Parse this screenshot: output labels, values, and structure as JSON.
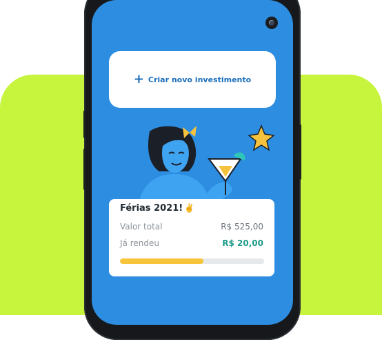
{
  "create_card": {
    "label": "Criar novo investimento",
    "icon": "plus-icon"
  },
  "investment": {
    "title": "Férias 2021!",
    "title_icon": "✌️",
    "rows": [
      {
        "label": "Valor total",
        "value": "R$ 525,00",
        "color": "#6b737b"
      },
      {
        "label": "Já rendeu",
        "value": "R$ 20,00",
        "color": "#1e9b8a"
      }
    ],
    "progress": 0.58
  },
  "colors": {
    "screen": "#2d8de0",
    "accent_bg": "#c7f43c",
    "brand": "#1c6ebc",
    "progress": "#f8c53a"
  }
}
